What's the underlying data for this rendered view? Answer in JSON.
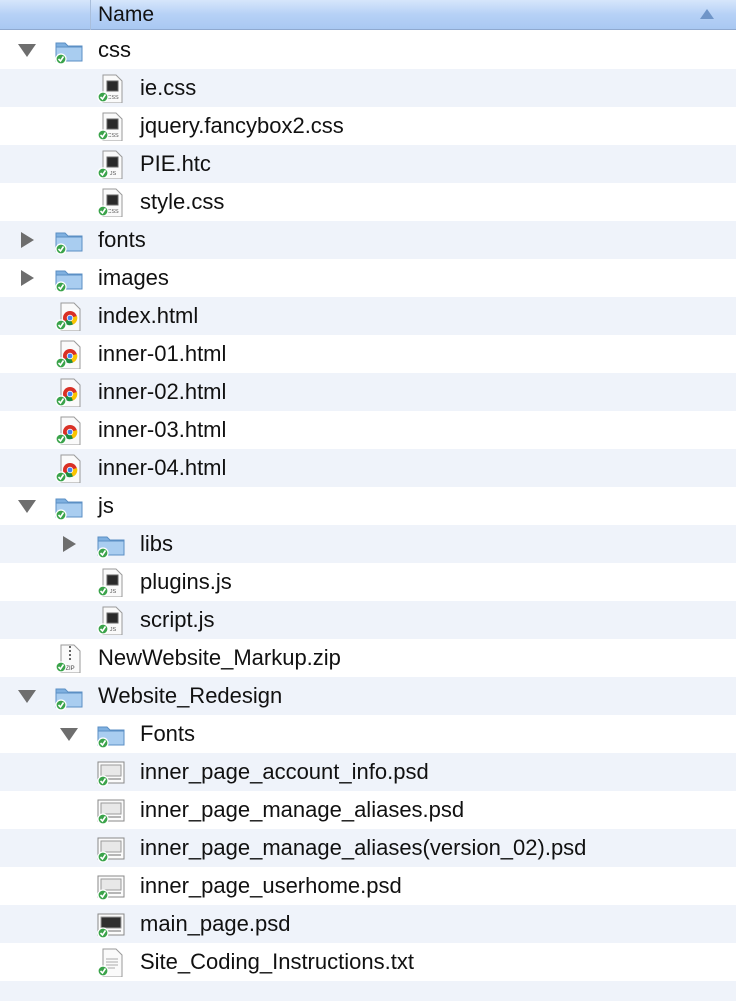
{
  "header": {
    "name_label": "Name"
  },
  "rows": [
    {
      "label": "css",
      "icon": "folder-icon",
      "level": 0,
      "expand": "open"
    },
    {
      "label": "ie.css",
      "icon": "css-file-icon",
      "level": 1,
      "expand": "none"
    },
    {
      "label": "jquery.fancybox2.css",
      "icon": "css-file-icon",
      "level": 1,
      "expand": "none"
    },
    {
      "label": "PIE.htc",
      "icon": "js-file-icon",
      "level": 1,
      "expand": "none"
    },
    {
      "label": "style.css",
      "icon": "css-file-icon",
      "level": 1,
      "expand": "none"
    },
    {
      "label": "fonts",
      "icon": "folder-icon",
      "level": 0,
      "expand": "closed"
    },
    {
      "label": "images",
      "icon": "folder-icon",
      "level": 0,
      "expand": "closed"
    },
    {
      "label": "index.html",
      "icon": "chrome-html-icon",
      "level": 0,
      "expand": "none"
    },
    {
      "label": "inner-01.html",
      "icon": "chrome-html-icon",
      "level": 0,
      "expand": "none"
    },
    {
      "label": "inner-02.html",
      "icon": "chrome-html-icon",
      "level": 0,
      "expand": "none"
    },
    {
      "label": "inner-03.html",
      "icon": "chrome-html-icon",
      "level": 0,
      "expand": "none"
    },
    {
      "label": "inner-04.html",
      "icon": "chrome-html-icon",
      "level": 0,
      "expand": "none"
    },
    {
      "label": "js",
      "icon": "folder-icon",
      "level": 0,
      "expand": "open"
    },
    {
      "label": "libs",
      "icon": "folder-icon",
      "level": 1,
      "expand": "closed"
    },
    {
      "label": "plugins.js",
      "icon": "js-file-icon",
      "level": 1,
      "expand": "none"
    },
    {
      "label": "script.js",
      "icon": "js-file-icon",
      "level": 1,
      "expand": "none"
    },
    {
      "label": "NewWebsite_Markup.zip",
      "icon": "zip-file-icon",
      "level": 0,
      "expand": "none"
    },
    {
      "label": "Website_Redesign",
      "icon": "folder-icon",
      "level": 0,
      "expand": "open"
    },
    {
      "label": "Fonts",
      "icon": "folder-icon",
      "level": 1,
      "expand": "open"
    },
    {
      "label": "inner_page_account_info.psd",
      "icon": "psd-file-icon",
      "level": 1,
      "expand": "none"
    },
    {
      "label": "inner_page_manage_aliases.psd",
      "icon": "psd-file-icon",
      "level": 1,
      "expand": "none"
    },
    {
      "label": "inner_page_manage_aliases(version_02).psd",
      "icon": "psd-file-icon",
      "level": 1,
      "expand": "none"
    },
    {
      "label": "inner_page_userhome.psd",
      "icon": "psd-file-icon",
      "level": 1,
      "expand": "none"
    },
    {
      "label": "main_page.psd",
      "icon": "psd-dark-file-icon",
      "level": 1,
      "expand": "none"
    },
    {
      "label": "Site_Coding_Instructions.txt",
      "icon": "text-file-icon",
      "level": 1,
      "expand": "none"
    }
  ],
  "colors": {
    "folder": "#8fb9e3",
    "badge": "#3aa34a",
    "stripe": "#eff3fa",
    "header": "#b6d1f6"
  },
  "icon_captions": {
    "css": "CSS",
    "js": "JS",
    "zip": "ZIP"
  }
}
